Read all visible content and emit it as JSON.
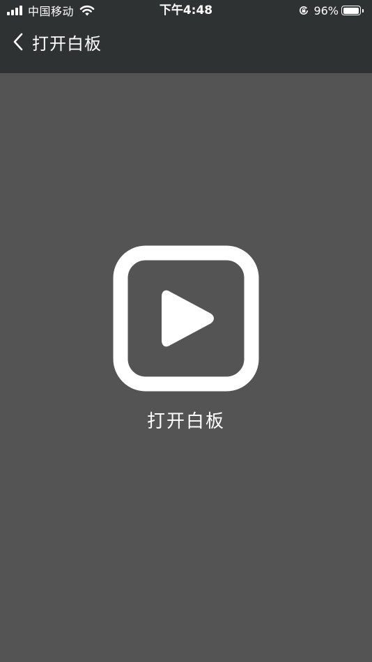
{
  "status_bar": {
    "carrier": "中国移动",
    "time": "下午4:48",
    "battery_percent": "96%",
    "battery_level": 0.96,
    "icons": [
      "signal-icon",
      "wifi-icon",
      "orientation-lock-icon",
      "battery-icon"
    ]
  },
  "nav": {
    "back_icon": "chevron-left-icon",
    "title": "打开白板"
  },
  "main": {
    "launcher_icon": "play-icon",
    "launcher_label": "打开白板"
  },
  "colors": {
    "background": "#545454",
    "header": "#2f3233",
    "foreground": "#ffffff"
  }
}
